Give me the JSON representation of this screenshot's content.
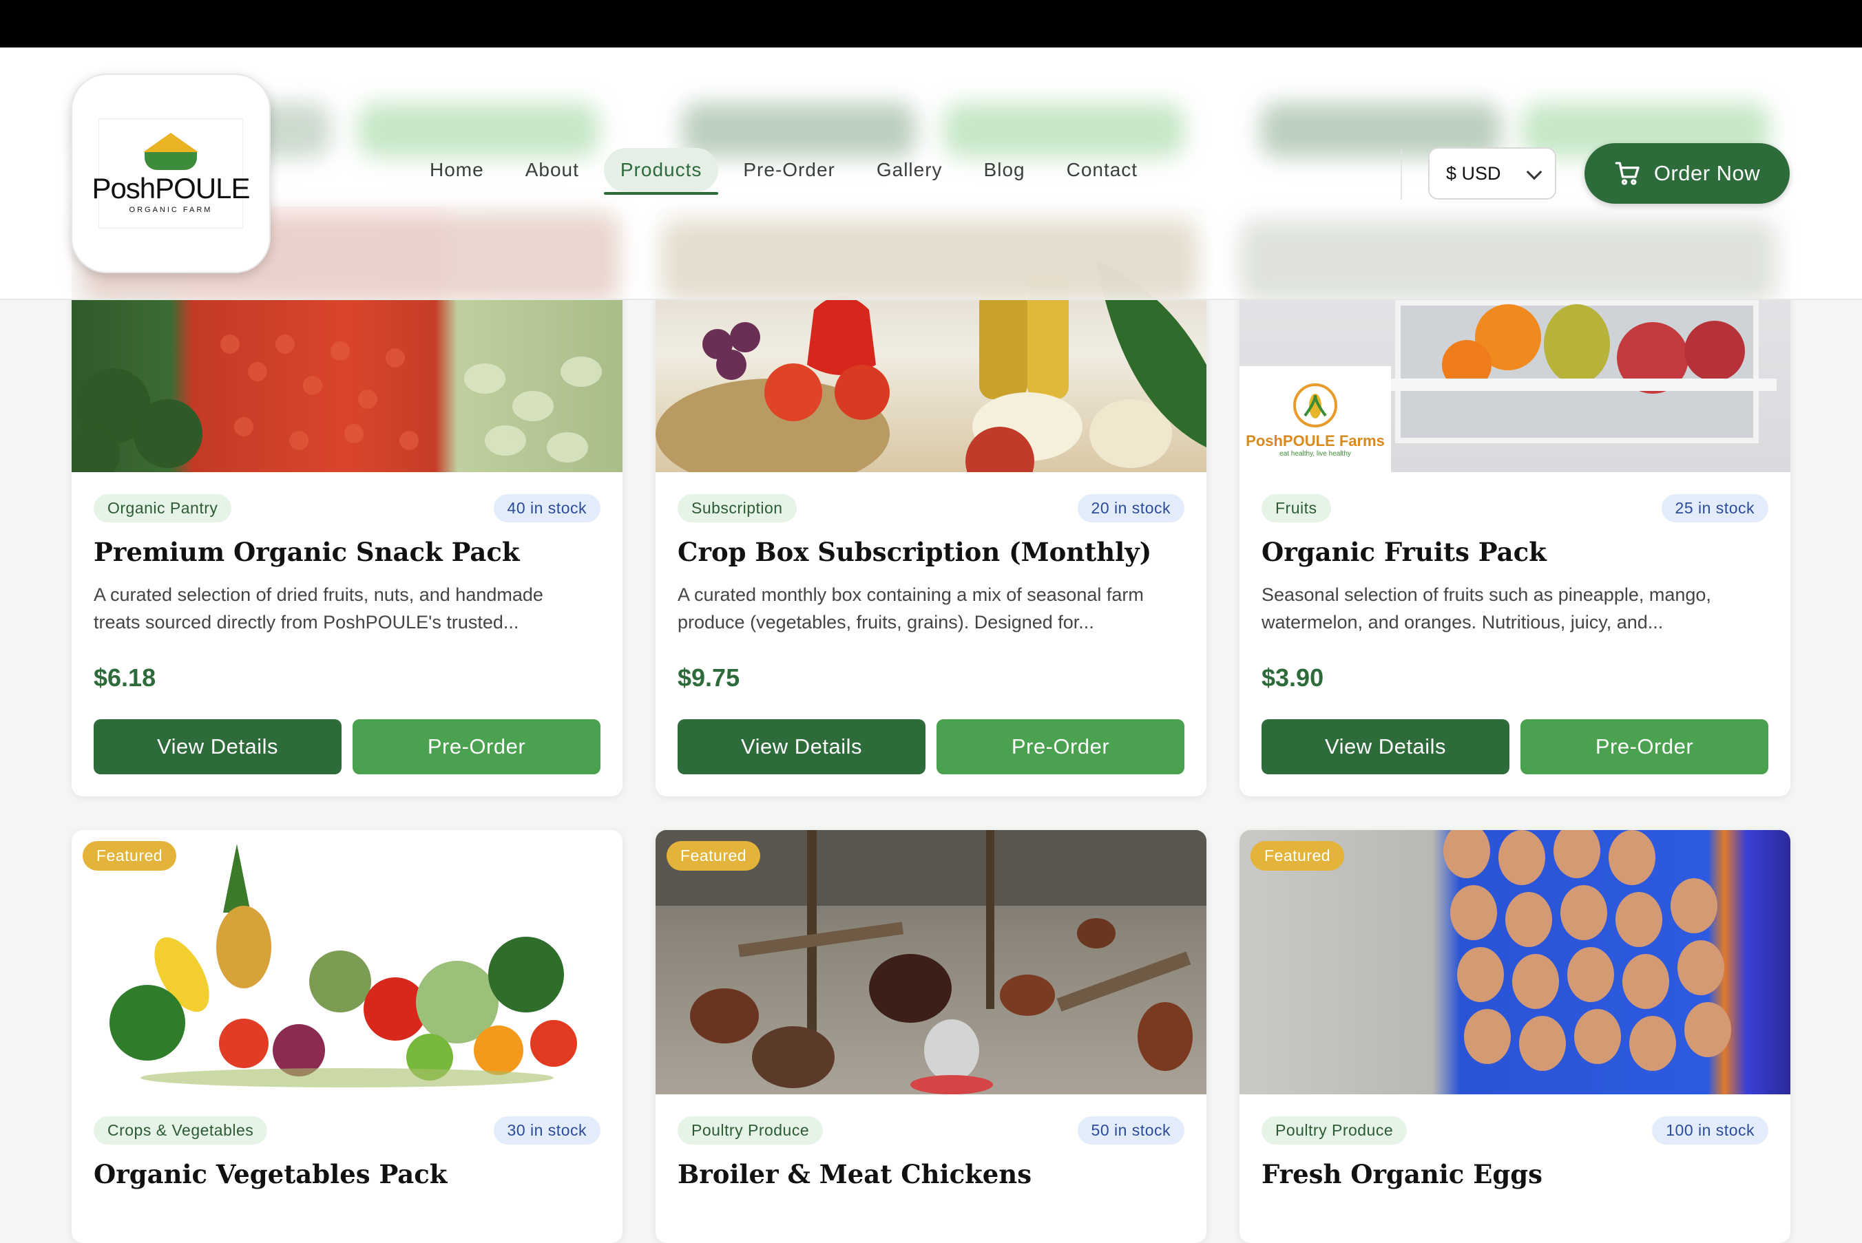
{
  "brand": {
    "name": "PoshPOULE",
    "tagline": "ORGANIC FARM"
  },
  "nav": {
    "items": [
      "Home",
      "About",
      "Products",
      "Pre-Order",
      "Gallery",
      "Blog",
      "Contact"
    ],
    "active": "Products"
  },
  "currency": {
    "selected": "$ USD"
  },
  "order_button": "Order Now",
  "colors": {
    "primary": "#2e6b3a",
    "accent": "#4aa14f",
    "featured": "#e4b33a",
    "stock_badge": "#e3ecfb"
  },
  "products": [
    {
      "category": "Organic Pantry",
      "stock": "40 in stock",
      "title": "Premium Organic Snack Pack",
      "desc1": "A curated selection of dried fruits, nuts, and handmade",
      "desc2": "treats sourced directly from PoshPOULE's trusted...",
      "price": "$6.18",
      "view": "View Details",
      "preorder": "Pre-Order"
    },
    {
      "category": "Subscription",
      "stock": "20 in stock",
      "title": "Crop Box Subscription (Monthly)",
      "desc1": "A curated monthly box containing a mix of seasonal farm",
      "desc2": "produce (vegetables, fruits, grains). Designed for...",
      "price": "$9.75",
      "view": "View Details",
      "preorder": "Pre-Order"
    },
    {
      "category": "Fruits",
      "stock": "25 in stock",
      "title": "Organic Fruits Pack",
      "desc1": "Seasonal selection of fruits such as pineapple, mango,",
      "desc2": "watermelon, and oranges. Nutritious, juicy, and...",
      "price": "$3.90",
      "view": "View Details",
      "preorder": "Pre-Order",
      "img_label": "PoshPOULE Farms",
      "img_sub": "eat healthy, live healthy"
    },
    {
      "badge": "Featured",
      "category": "Crops & Vegetables",
      "stock": "30 in stock",
      "title": "Organic Vegetables Pack"
    },
    {
      "badge": "Featured",
      "category": "Poultry Produce",
      "stock": "50 in stock",
      "title": "Broiler & Meat Chickens"
    },
    {
      "badge": "Featured",
      "category": "Poultry Produce",
      "stock": "100 in stock",
      "title": "Fresh Organic Eggs"
    }
  ]
}
